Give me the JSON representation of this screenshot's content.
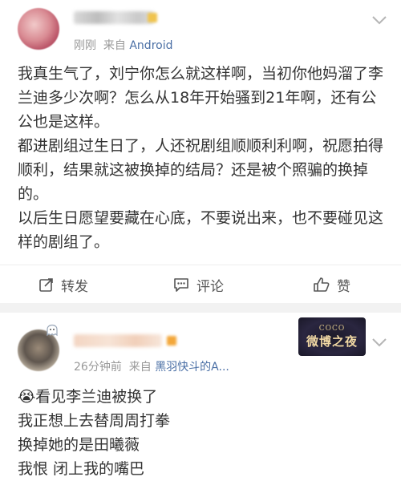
{
  "post1": {
    "time": "刚刚",
    "source_prefix": "来自",
    "source": "Android",
    "lines": [
      "我真生气了，刘宁你怎么就这样啊，当初你他妈溜了李兰迪多少次啊？怎么从18年开始骚到21年啊，还有公公也是这样。",
      "都进剧组过生日了，人还祝剧组顺顺利利啊，祝愿拍得顺利，结果就这被换掉的结局？还是被个照骗的换掉的。",
      "以后生日愿望要藏在心底，不要说出来，也不要碰见这样的剧组了。"
    ],
    "actions": {
      "repost": "转发",
      "comment": "评论",
      "like": "赞"
    }
  },
  "post2": {
    "time": "26分钟前",
    "source_prefix": "来自",
    "source": "黑羽快斗的A...",
    "badge_top": "COCO",
    "badge_main": "微博之夜",
    "lines": [
      "😭看见李兰迪被换了",
      "我正想上去替周周打拳",
      "换掉她的是田曦薇",
      "我恨 闭上我的嘴巴"
    ]
  },
  "colors": {
    "link": "#4a6fa5",
    "meta": "#999999",
    "text": "#333333",
    "background": "#f2f2f2"
  },
  "icons": [
    "chevron-down-icon",
    "repost-icon",
    "comment-icon",
    "like-icon",
    "ghost-icon"
  ]
}
